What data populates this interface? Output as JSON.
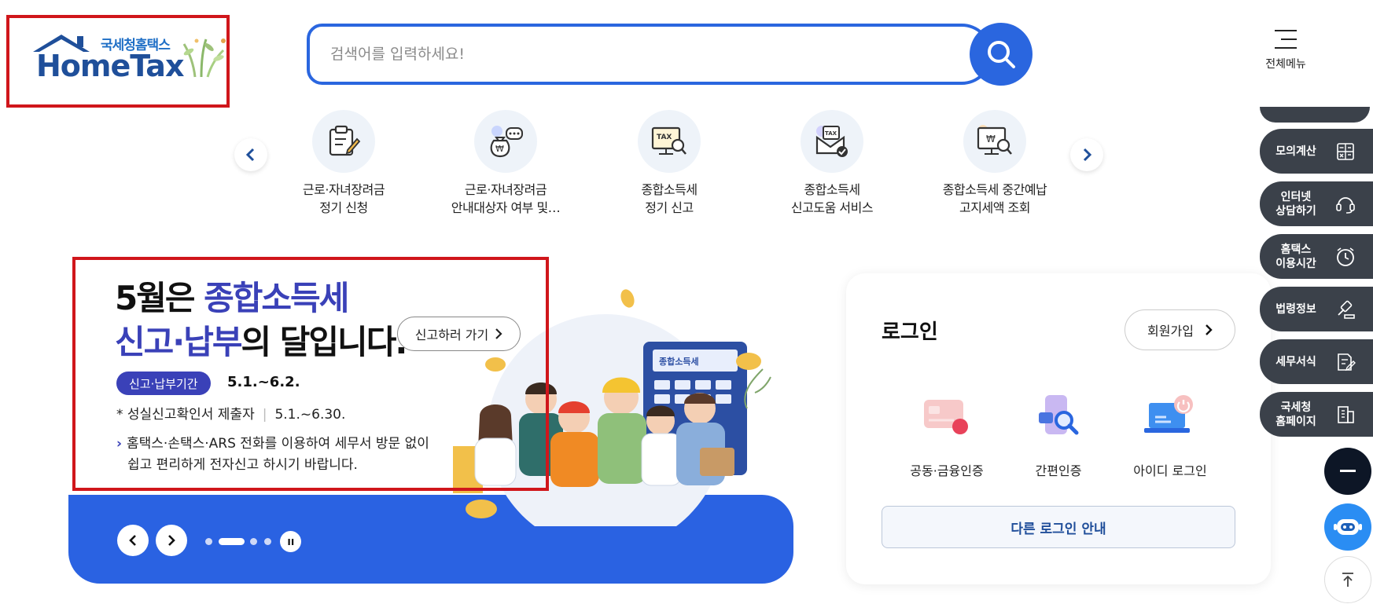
{
  "header": {
    "logo_sub": "국세청홈택스",
    "logo_main": "HomeTax",
    "search_placeholder": "검색어를 입력하세요!",
    "all_menu_label": "전체메뉴"
  },
  "quick_menu": [
    {
      "line1": "근로·자녀장려금",
      "line2": "정기 신청",
      "icon": "document-pen-icon"
    },
    {
      "line1": "근로·자녀장려금",
      "line2": "안내대상자 여부 및…",
      "icon": "money-bag-chat-icon"
    },
    {
      "line1": "종합소득세",
      "line2": "정기 신고",
      "icon": "tax-monitor-search-icon"
    },
    {
      "line1": "종합소득세",
      "line2": "신고도움 서비스",
      "icon": "tax-envelope-check-icon"
    },
    {
      "line1": "종합소득세 중간예납",
      "line2": "고지세액 조회",
      "icon": "won-monitor-search-icon"
    }
  ],
  "banner": {
    "title_part1": "5월은 ",
    "title_part2": "종합소득세",
    "title_part3": "신고·납부",
    "title_part4": "의 달입니다.",
    "go_button": "신고하러 가기",
    "badge": "신고·납부기간",
    "period": "5.1.~6.2.",
    "line2_label": "* 성실신고확인서 제출자",
    "line2_period": "5.1.~6.30.",
    "note_line1": "홈택스·손택스·ARS 전화를 이용하여 세무서 방문 없이",
    "note_line2": "쉽고 편리하게 전자신고 하시기 바랍니다.",
    "calculator_label": "종합소득세"
  },
  "login": {
    "title": "로그인",
    "join": "회원가입",
    "options": [
      {
        "label": "공동·금융인증",
        "icon": "certificate-card-icon"
      },
      {
        "label": "간편인증",
        "icon": "simple-auth-search-icon"
      },
      {
        "label": "아이디 로그인",
        "icon": "id-laptop-icon"
      }
    ],
    "other": "다른 로그인 안내"
  },
  "side_rail": [
    {
      "label1": "모의계산",
      "label2": "",
      "icon": "calculator-icon"
    },
    {
      "label1": "인터넷",
      "label2": "상담하기",
      "icon": "headset-icon"
    },
    {
      "label1": "홈택스",
      "label2": "이용시간",
      "icon": "clock-icon"
    },
    {
      "label1": "법령정보",
      "label2": "",
      "icon": "gavel-icon"
    },
    {
      "label1": "세무서식",
      "label2": "",
      "icon": "form-document-icon"
    },
    {
      "label1": "국세청",
      "label2": "홈페이지",
      "icon": "building-icon"
    }
  ],
  "colors": {
    "primary_blue": "#2a66df",
    "banner_blue": "#2a62e2",
    "title_indigo": "#3a41b8",
    "rail_dark": "#3b414a",
    "highlight_red": "#d0161b"
  }
}
